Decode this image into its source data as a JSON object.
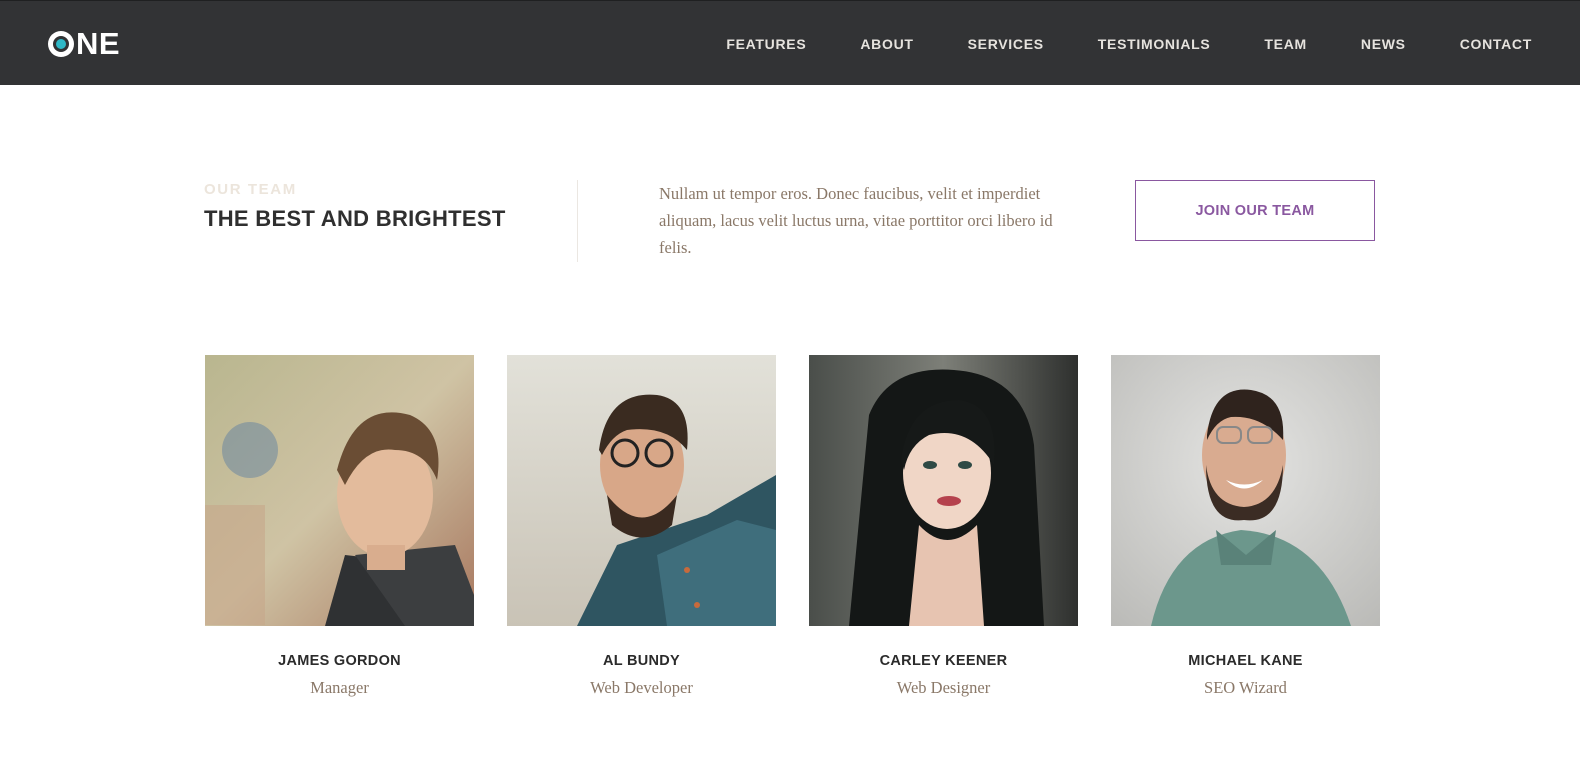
{
  "brand": {
    "logo_text": "NE",
    "logo_accent_color": "#2fb8c7",
    "navbar_bg": "#323335"
  },
  "nav": {
    "items": [
      "FEATURES",
      "ABOUT",
      "SERVICES",
      "TESTIMONIALS",
      "TEAM",
      "NEWS",
      "CONTACT"
    ]
  },
  "section": {
    "eyebrow": "OUR TEAM",
    "title": "THE BEST AND BRIGHTEST",
    "intro": "Nullam ut tempor eros. Donec faucibus, velit et imperdiet aliquam, lacus velit luctus urna, vitae porttitor orci libero id felis.",
    "cta_label": "JOIN OUR TEAM",
    "cta_color": "#8a58a0"
  },
  "team": [
    {
      "name": "JAMES GORDON",
      "role": "Manager",
      "photo_icon": "person-portrait-icon"
    },
    {
      "name": "AL BUNDY",
      "role": "Web Developer",
      "photo_icon": "person-portrait-icon"
    },
    {
      "name": "CARLEY KEENER",
      "role": "Web Designer",
      "photo_icon": "person-portrait-icon"
    },
    {
      "name": "MICHAEL KANE",
      "role": "SEO Wizard",
      "photo_icon": "person-portrait-icon"
    }
  ]
}
